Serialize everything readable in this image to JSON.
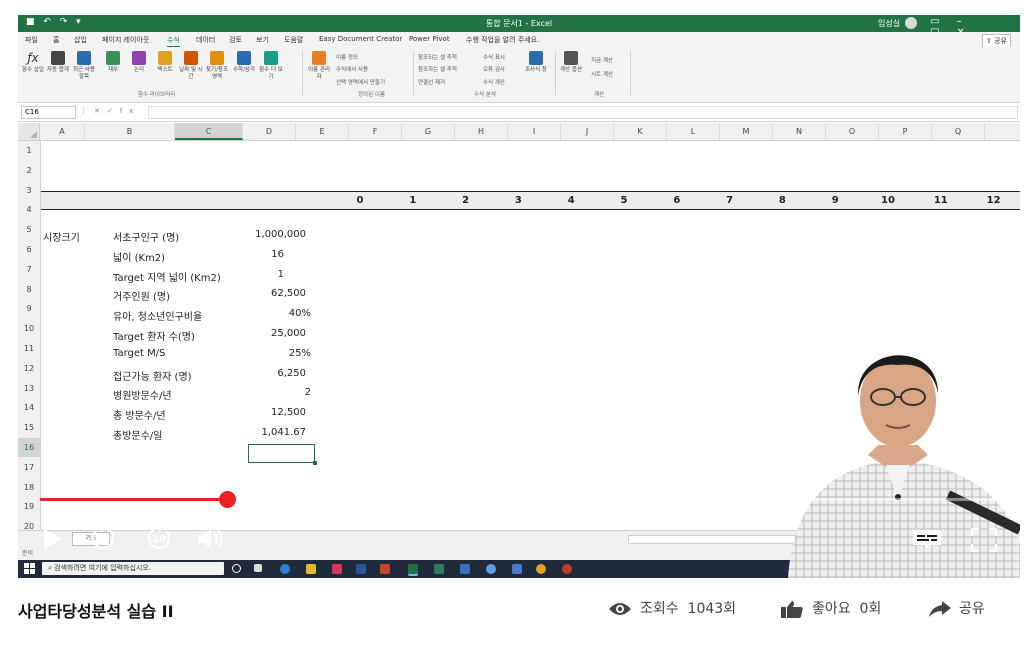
{
  "excel": {
    "title": "통합 문서1 - Excel",
    "account": "임성실",
    "menu_tabs": [
      "파일",
      "홈",
      "삽입",
      "페이지 레이아웃",
      "수식",
      "데이터",
      "검토",
      "보기",
      "도움말",
      "Easy Document Creator",
      "Power Pivot",
      "수행 작업을 알려 주세요."
    ],
    "active_tab": "수식",
    "share_label": "공유",
    "ribbon": {
      "buttons": [
        "함수 삽입",
        "자동 합계",
        "최근 사용 항목",
        "재무",
        "논리",
        "텍스트",
        "날짜 및 시간",
        "찾기/참조 영역",
        "수학/삼각",
        "함수 더 보기",
        "이름 관리자",
        "조사식 창",
        "계산 옵션"
      ],
      "small_items": [
        "이름 정의",
        "수식에서 사용",
        "선택 영역에서 만들기",
        "참조되는 셀 추적",
        "참조하는 셀 추적",
        "연결선 제거",
        "수식 표시",
        "오류 검사",
        "수식 계산",
        "지금 계산",
        "시트 계산"
      ],
      "groups": [
        "함수 라이브러리",
        "정의된 이름",
        "수식 분석",
        "계산"
      ]
    },
    "name_box": "C16",
    "fx": "fx",
    "col_headers": [
      "A",
      "B",
      "C",
      "D",
      "E",
      "F",
      "G",
      "H",
      "I",
      "J",
      "K",
      "L",
      "M",
      "N",
      "O",
      "P",
      "Q"
    ],
    "row_headers": [
      "1",
      "2",
      "3",
      "4",
      "5",
      "6",
      "7",
      "8",
      "9",
      "10",
      "11",
      "12",
      "13",
      "14",
      "15",
      "16",
      "17",
      "18",
      "19",
      "20"
    ],
    "row4_numbers": [
      "0",
      "1",
      "2",
      "3",
      "4",
      "5",
      "6",
      "7",
      "8",
      "9",
      "10",
      "11",
      "12"
    ],
    "section_label": "시장크기",
    "rows": [
      {
        "label": "서초구인구 (명)",
        "value": "1,000,000"
      },
      {
        "label": "넓이 (Km2)",
        "value": "16"
      },
      {
        "label": "Target 지역 넓이 (Km2)",
        "value": "1"
      },
      {
        "label": "거주인원 (명)",
        "value": "62,500"
      },
      {
        "label": "유아, 청소년인구비율",
        "value": "40%"
      },
      {
        "label": "Target 환자 수(명)",
        "value": "25,000"
      },
      {
        "label": "Target M/S",
        "value": "25%"
      },
      {
        "label": "접근가능 환자 (명)",
        "value": "6,250"
      },
      {
        "label": "병원방문수/년",
        "value": "2"
      },
      {
        "label": "총 방문수/년",
        "value": "12,500"
      },
      {
        "label": "총방문수/일",
        "value": "1,041.67"
      }
    ],
    "sheet_tab": "기초",
    "status": "준비",
    "taskbar_search": "검색하려면 여기에 입력하십시오."
  },
  "player": {
    "progress_percent": 19.5,
    "rewind_seconds": "10",
    "forward_seconds": "10"
  },
  "video": {
    "title": "사업타당성분석 실습 II",
    "views_label": "조회수",
    "views_value": "1043회",
    "likes_label": "좋아요",
    "likes_value": "0회",
    "share_label": "공유"
  },
  "colors": {
    "excel_green": "#217346",
    "progress_red": "#ea2227"
  }
}
